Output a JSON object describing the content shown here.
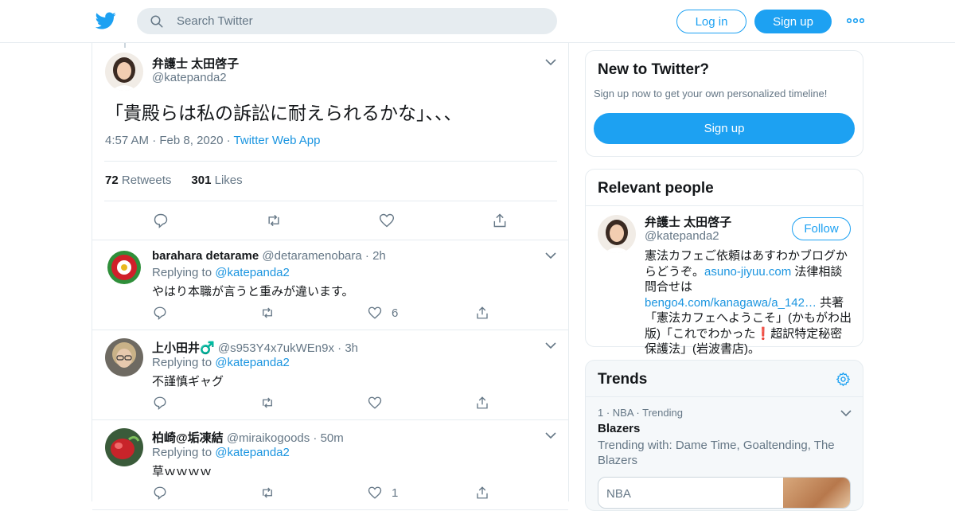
{
  "header": {
    "search_placeholder": "Search Twitter",
    "login_label": "Log in",
    "signup_label": "Sign up"
  },
  "tweet": {
    "author_name": "弁護士 太田啓子",
    "author_handle": "@katepanda2",
    "text": "「貴殿らは私の訴訟に耐えられるかな」、、、",
    "time": "4:57 AM",
    "date": "Feb 8, 2020",
    "source": "Twitter Web App",
    "retweets_count": "72",
    "retweets_label": "Retweets",
    "likes_count": "301",
    "likes_label": "Likes"
  },
  "replies": [
    {
      "name": "barahara detarame",
      "handle": "@detaramenobara",
      "time": "2h",
      "replying_label": "Replying to",
      "replying_handle": "@katepanda2",
      "text": "やはり本職が言うと重みが違います。",
      "likes": "6"
    },
    {
      "name": "上小田井♂️",
      "handle": "@s953Y4x7ukWEn9x",
      "time": "3h",
      "replying_label": "Replying to",
      "replying_handle": "@katepanda2",
      "text": "不謹慎ギャグ",
      "likes": ""
    },
    {
      "name": "柏崎@垢凍結",
      "handle": "@miraikogoods",
      "time": "50m",
      "replying_label": "Replying to",
      "replying_handle": "@katepanda2",
      "text": "草ｗｗｗｗ",
      "likes": "1"
    }
  ],
  "sidebar": {
    "new_title": "New to Twitter?",
    "new_text": "Sign up now to get your own personalized timeline!",
    "new_button": "Sign up",
    "relevant_title": "Relevant people",
    "person": {
      "name": "弁護士 太田啓子",
      "handle": "@katepanda2",
      "follow_label": "Follow",
      "bio_1": "憲法カフェご依頼はあすわかブログからどうぞ。",
      "bio_link_1": "asuno-jiyuu.com",
      "bio_2": " 法律相談問合せは",
      "bio_link_2": "bengo4.com/kanagawa/a_142…",
      "bio_3": " 共著「憲法カフェへようこそ」(かもがわ出版)「これでわかった",
      "bio_emoji": "❗",
      "bio_4": "超訳特定秘密保護法」(岩波書店)。"
    },
    "trends_title": "Trends",
    "trend": {
      "rank": "1",
      "category": "NBA",
      "status": "Trending",
      "name": "Blazers",
      "with": "Trending with: Dame Time, Goaltending, The Blazers",
      "news_source": "NBA"
    }
  },
  "colors": {
    "accent": "#1da1f2",
    "link": "#1b95e0",
    "muted": "#657786",
    "border": "#e6ecf0"
  }
}
